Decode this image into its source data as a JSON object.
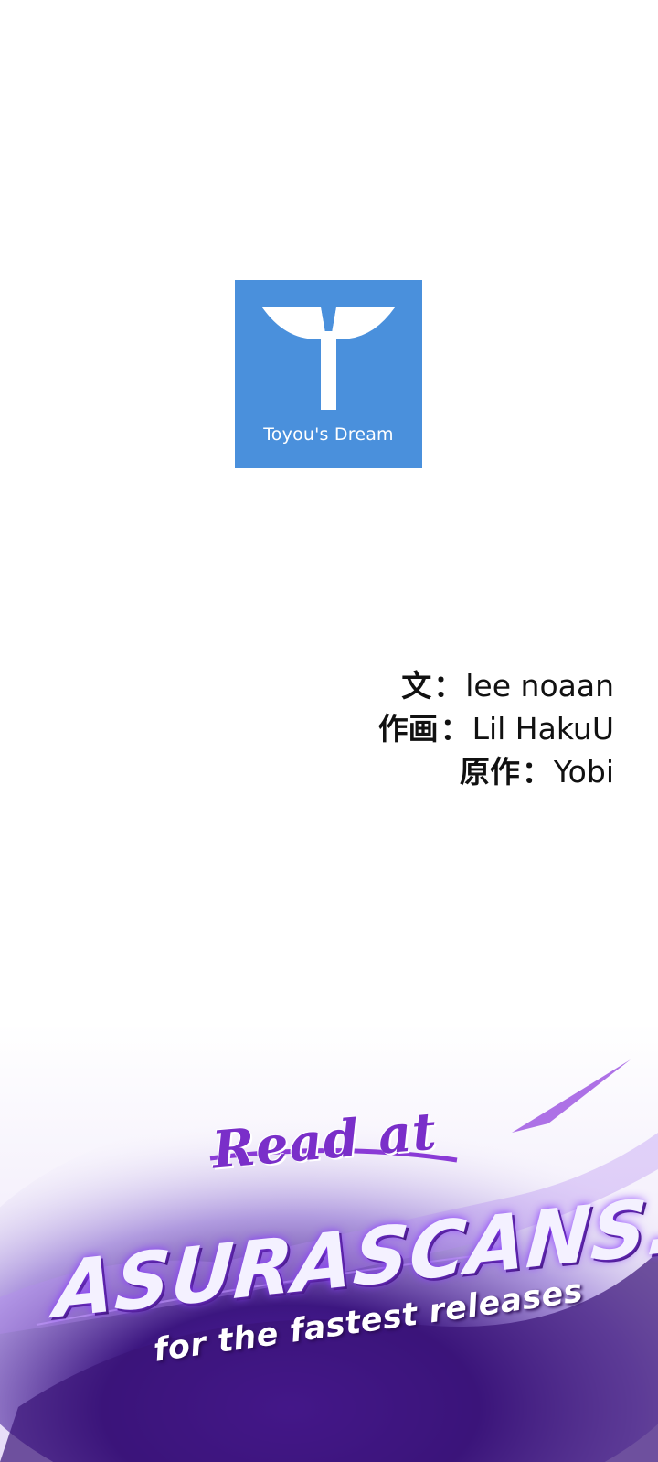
{
  "logo": {
    "icon": "sprout-icon",
    "brand_name": "Toyou's Dream",
    "color": "#4a90dc"
  },
  "credits": [
    {
      "label": "文",
      "separator": "：",
      "value": "lee noaan"
    },
    {
      "label": "作画",
      "separator": "：",
      "value": "Lil HakuU"
    },
    {
      "label": "原作",
      "separator": "：",
      "value": "Yobi"
    }
  ],
  "promo": {
    "line1": "Read at",
    "site": "ASURASCANS.COM",
    "tagline": "for the fastest releases",
    "accent_color": "#7a2fc9"
  }
}
